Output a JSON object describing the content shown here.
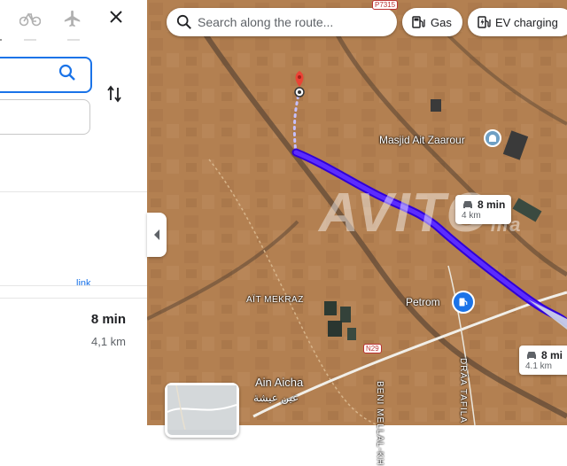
{
  "sidebar": {
    "modes": [
      {
        "name": "bicycle-icon"
      },
      {
        "name": "flight-icon"
      }
    ],
    "close_icon": "close-icon",
    "swap_icon": "swap-vert-icon",
    "link_partial": "link",
    "route": {
      "time": "8 min",
      "distance": "4,1 km"
    }
  },
  "map": {
    "search_placeholder": "Search along the route...",
    "chips": [
      {
        "icon": "gas-pump-icon",
        "label": "Gas"
      },
      {
        "icon": "ev-charging-icon",
        "label": "EV charging"
      }
    ],
    "places": {
      "masjid": "Masjid Ait Zaarour",
      "ait_mekraz": "AÏT MEKRAZ",
      "petrom": "Petrom",
      "ain_aicha": "Ain Aicha",
      "ain_aicha_ar": "عين عيشة",
      "beni_mellal": "BENI MELLAL-KH",
      "draa": "DRÂA TAFILA",
      "road_top": "P7315",
      "road_mid": "N29"
    },
    "callouts": [
      {
        "time": "8 min",
        "distance": "4 km"
      },
      {
        "time": "8 mi",
        "distance": "4.1 km"
      }
    ],
    "watermark": "AVITO",
    "watermark_suffix": "ma",
    "colors": {
      "route": "#4a22ff",
      "accent": "#1a73e8",
      "pin": "#ea4335"
    }
  }
}
